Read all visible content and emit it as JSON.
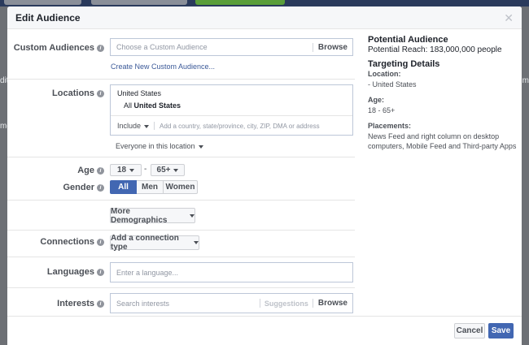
{
  "dialog": {
    "title": "Edit Audience"
  },
  "background": {
    "left_texts": [
      "dit",
      "me"
    ],
    "right_text": "tim"
  },
  "custom_audiences": {
    "label": "Custom Audiences",
    "placeholder": "Choose a Custom Audience",
    "browse": "Browse",
    "create_link": "Create New Custom Audience..."
  },
  "locations": {
    "label": "Locations",
    "country": "United States",
    "all_prefix": "All",
    "all_value": "United States",
    "include": "Include",
    "add_placeholder": "Add a country, state/province, city, ZIP, DMA or address",
    "everyone": "Everyone in this location"
  },
  "age": {
    "label": "Age",
    "min": "18",
    "max": "65+",
    "dash": "-"
  },
  "gender": {
    "label": "Gender",
    "options": [
      "All",
      "Men",
      "Women"
    ],
    "selected": "All"
  },
  "more_demographics": "More Demographics",
  "connections": {
    "label": "Connections",
    "button": "Add a connection type"
  },
  "languages": {
    "label": "Languages",
    "placeholder": "Enter a language..."
  },
  "interests": {
    "label": "Interests",
    "placeholder": "Search interests",
    "suggestions": "Suggestions",
    "browse": "Browse"
  },
  "summary": {
    "potential_audience": "Potential Audience",
    "potential_reach": "Potential Reach: 183,000,000 people",
    "targeting_details": "Targeting Details",
    "location_label": "Location:",
    "location_value": "- United States",
    "age_label": "Age:",
    "age_value": "18 - 65+",
    "placements_label": "Placements:",
    "placements_value": "News Feed and right column on desktop computers, Mobile Feed and Third-party Apps"
  },
  "footer": {
    "cancel": "Cancel",
    "save": "Save"
  },
  "colors": {
    "primary": "#4267b2",
    "header_bg": "#f6f7f9",
    "border": "#e5e5e5",
    "link": "#3b5998"
  }
}
